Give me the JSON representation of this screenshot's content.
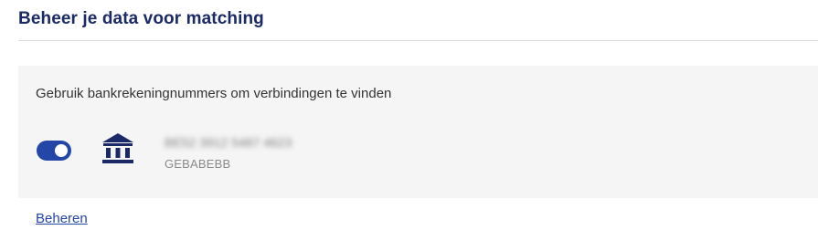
{
  "section": {
    "title": "Beheer je data voor matching"
  },
  "card": {
    "description": "Gebruik bankrekeningnummers om verbindingen te vinden",
    "account": {
      "enabled": true,
      "icon": "bank-icon",
      "iban": "BE52 3912 5487 4623",
      "bic": "GEBABEBB"
    }
  },
  "actions": {
    "manage_label": "Beheren"
  },
  "colors": {
    "heading": "#1b2a66",
    "accent": "#2447a7",
    "card_background": "#f5f5f5"
  }
}
